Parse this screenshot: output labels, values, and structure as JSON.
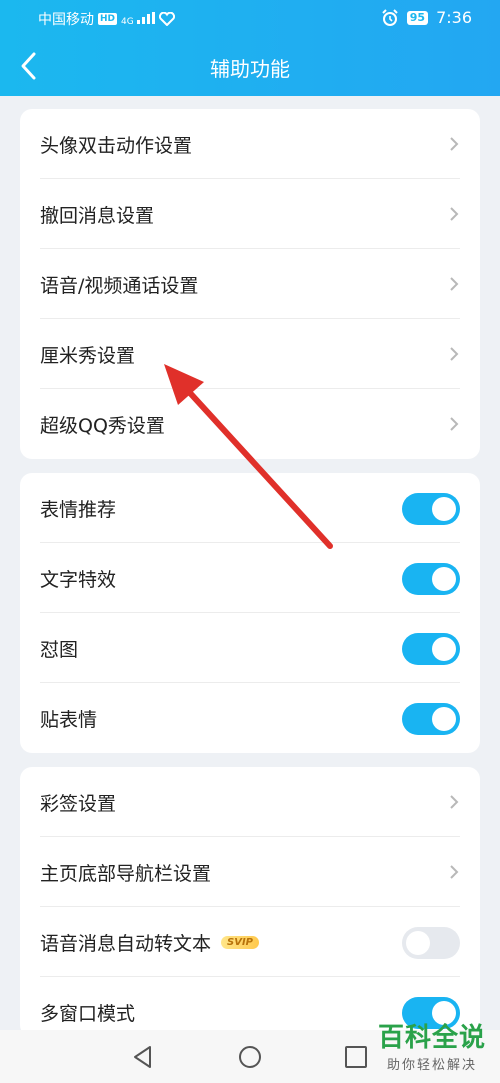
{
  "status_bar": {
    "carrier": "中国移动",
    "hd": "HD",
    "signal": "4G",
    "battery": "95",
    "time": "7:36"
  },
  "header": {
    "title": "辅助功能"
  },
  "group1": [
    {
      "label": "头像双击动作设置"
    },
    {
      "label": "撤回消息设置"
    },
    {
      "label": "语音/视频通话设置"
    },
    {
      "label": "厘米秀设置"
    },
    {
      "label": "超级QQ秀设置"
    }
  ],
  "group2": [
    {
      "label": "表情推荐",
      "on": true
    },
    {
      "label": "文字特效",
      "on": true
    },
    {
      "label": "怼图",
      "on": true
    },
    {
      "label": "贴表情",
      "on": true
    }
  ],
  "group3": [
    {
      "label": "彩签设置"
    },
    {
      "label": "主页底部导航栏设置"
    },
    {
      "label": "语音消息自动转文本",
      "badge": "SVIP",
      "on": false
    },
    {
      "label": "多窗口模式",
      "on": true
    }
  ],
  "watermark": {
    "title": "百科全说",
    "subtitle": "助你轻松解决"
  },
  "colors": {
    "accent": "#19b4f2",
    "arrow": "#e0302a"
  }
}
